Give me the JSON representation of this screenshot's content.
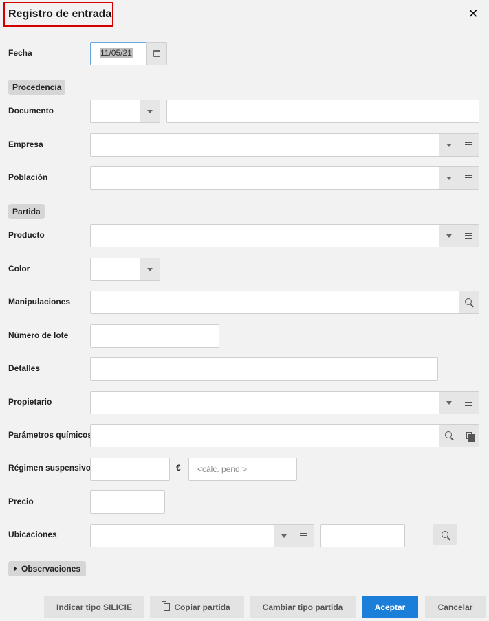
{
  "dialog": {
    "title": "Registro de entrada",
    "close_label": "✕"
  },
  "fecha": {
    "label": "Fecha",
    "value": "11/05/21"
  },
  "sections": {
    "procedencia": "Procedencia",
    "partida": "Partida",
    "observaciones": "Observaciones"
  },
  "fields": {
    "documento": "Documento",
    "empresa": "Empresa",
    "poblacion": "Población",
    "producto": "Producto",
    "color": "Color",
    "manipulaciones": "Manipulaciones",
    "numero_lote": "Número de lote",
    "detalles": "Detalles",
    "propietario": "Propietario",
    "parametros_quimicos": "Parámetros químicos",
    "regimen_suspensivo": "Régimen suspensivo",
    "precio": "Precio",
    "ubicaciones": "Ubicaciones"
  },
  "regimen": {
    "currency": "€",
    "placeholder": "<cálc. pend.>"
  },
  "footer": {
    "indicar_tipo": "Indicar tipo SILICIE",
    "copiar_partida": "Copiar partida",
    "cambiar_tipo": "Cambiar tipo partida",
    "aceptar": "Aceptar",
    "cancelar": "Cancelar"
  },
  "colors": {
    "primary": "#1b7fd9",
    "title_border": "#d40000"
  }
}
